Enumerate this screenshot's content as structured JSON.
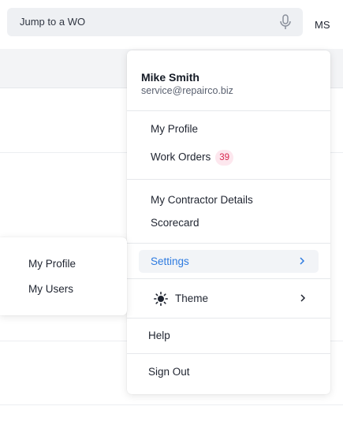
{
  "search": {
    "placeholder": "Jump to a WO",
    "icon": "microphone-icon"
  },
  "user_avatar": {
    "initials": "MS"
  },
  "menu": {
    "user": {
      "name": "Mike Smith",
      "email": "service@repairco.biz"
    },
    "items": {
      "my_profile": "My Profile",
      "work_orders": "Work Orders",
      "work_orders_badge": "39",
      "contractor_details": "My Contractor Details",
      "scorecard": "Scorecard",
      "settings": "Settings",
      "theme": "Theme",
      "help": "Help",
      "sign_out": "Sign Out"
    },
    "icons": {
      "settings_chevron": "chevron-right-icon",
      "theme": "sun-icon",
      "theme_chevron": "chevron-right-icon"
    },
    "colors": {
      "active": "#2e7be0",
      "badge_bg": "#fde7ee",
      "badge_text": "#d8284f"
    }
  },
  "settings_submenu": {
    "items": [
      "My Profile",
      "My Users"
    ]
  }
}
